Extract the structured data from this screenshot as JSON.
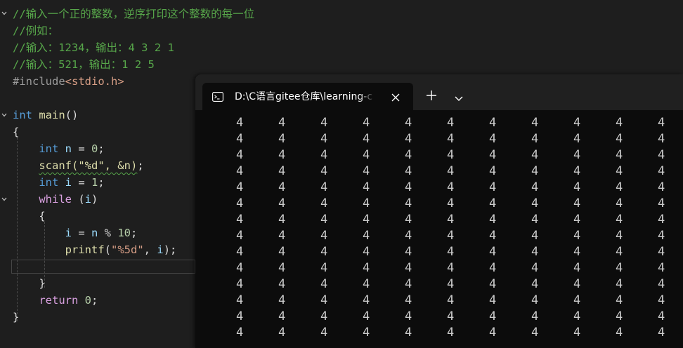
{
  "editor": {
    "lines": [
      [
        {
          "t": "//输入一个正的整数，逆序打印这个整数的每一位",
          "c": "c-comment"
        }
      ],
      [
        {
          "t": "//例如：",
          "c": "c-comment"
        }
      ],
      [
        {
          "t": "//输入：1234，输出：4 3 2 1",
          "c": "c-comment"
        }
      ],
      [
        {
          "t": "//输入：521，输出：1 2 5",
          "c": "c-comment"
        }
      ],
      [
        {
          "t": "#include",
          "c": "c-pp"
        },
        {
          "t": "<stdio.h>",
          "c": "c-str"
        }
      ],
      [],
      [
        {
          "t": "int",
          "c": "c-kw"
        },
        {
          "t": " ",
          "c": "c-id"
        },
        {
          "t": "main",
          "c": "c-fn"
        },
        {
          "t": "()",
          "c": "c-id"
        }
      ],
      [
        {
          "t": "{",
          "c": "c-id"
        }
      ],
      [
        {
          "t": "    ",
          "c": "c-id"
        },
        {
          "t": "int",
          "c": "c-kw"
        },
        {
          "t": " ",
          "c": "c-id"
        },
        {
          "t": "n",
          "c": "c-var"
        },
        {
          "t": " = ",
          "c": "c-id"
        },
        {
          "t": "0",
          "c": "c-num"
        },
        {
          "t": ";",
          "c": "c-id"
        }
      ],
      [
        {
          "t": "    ",
          "c": "c-id"
        },
        {
          "t": "scanf(\"%d\", &n)",
          "c": "c-fn squiggle"
        },
        {
          "t": ";",
          "c": "c-id"
        }
      ],
      [
        {
          "t": "    ",
          "c": "c-id"
        },
        {
          "t": "int",
          "c": "c-kw"
        },
        {
          "t": " ",
          "c": "c-id"
        },
        {
          "t": "i",
          "c": "c-var"
        },
        {
          "t": " = ",
          "c": "c-id"
        },
        {
          "t": "1",
          "c": "c-num"
        },
        {
          "t": ";",
          "c": "c-id"
        }
      ],
      [
        {
          "t": "    ",
          "c": "c-id"
        },
        {
          "t": "while",
          "c": "c-ctl"
        },
        {
          "t": " (",
          "c": "c-id"
        },
        {
          "t": "i",
          "c": "c-var"
        },
        {
          "t": ")",
          "c": "c-id"
        }
      ],
      [
        {
          "t": "    {",
          "c": "c-id"
        }
      ],
      [
        {
          "t": "        ",
          "c": "c-id"
        },
        {
          "t": "i",
          "c": "c-var"
        },
        {
          "t": " = ",
          "c": "c-id"
        },
        {
          "t": "n",
          "c": "c-var"
        },
        {
          "t": " % ",
          "c": "c-id"
        },
        {
          "t": "10",
          "c": "c-num"
        },
        {
          "t": ";",
          "c": "c-id"
        }
      ],
      [
        {
          "t": "        ",
          "c": "c-id"
        },
        {
          "t": "printf",
          "c": "c-fn"
        },
        {
          "t": "(",
          "c": "c-id"
        },
        {
          "t": "\"%5d\"",
          "c": "c-str"
        },
        {
          "t": ", ",
          "c": "c-id"
        },
        {
          "t": "i",
          "c": "c-var"
        },
        {
          "t": ");",
          "c": "c-id"
        }
      ],
      [],
      [
        {
          "t": "    }",
          "c": "c-id"
        }
      ],
      [
        {
          "t": "    ",
          "c": "c-id"
        },
        {
          "t": "return",
          "c": "c-ctl"
        },
        {
          "t": " ",
          "c": "c-id"
        },
        {
          "t": "0",
          "c": "c-num"
        },
        {
          "t": ";",
          "c": "c-id"
        }
      ],
      [
        {
          "t": "}",
          "c": "c-id"
        }
      ]
    ],
    "fold_icon": "chevron-down-icon"
  },
  "terminal": {
    "tab_title": "D:\\C语言gitee仓库\\learning-c",
    "tab_icon": "terminal-app-icon",
    "close_icon": "close-icon",
    "new_tab_icon": "plus-icon",
    "dropdown_icon": "chevron-down-icon",
    "output_digit": "4",
    "visible_rows": 14,
    "visible_columns": 11
  },
  "colors": {
    "editor_bg": "#1e1e1e",
    "comment": "#57a64a",
    "keyword": "#569cd6",
    "terminal_bg": "#0c0c0c",
    "titlebar_bg": "#202020"
  }
}
